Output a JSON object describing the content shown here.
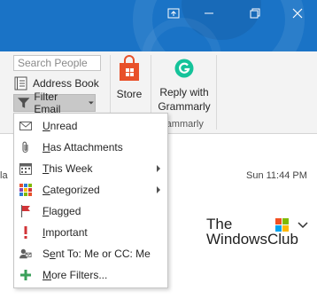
{
  "window": {
    "buttons": [
      {
        "name": "touch-mode-icon"
      },
      {
        "name": "minimize-icon"
      },
      {
        "name": "restore-icon"
      },
      {
        "name": "close-icon"
      }
    ]
  },
  "ribbon": {
    "search_placeholder": "Search People",
    "address_book_label": "Address Book",
    "filter_email_label": "Filter Email",
    "store_label": "Store",
    "reply_grammarly_line1": "Reply with",
    "reply_grammarly_line2": "Grammarly",
    "group_label_fragment": "rammarly"
  },
  "content": {
    "left_fragment": "la",
    "date": "Sun 11:44 PM",
    "watermark_line1": "The",
    "watermark_line2": "WindowsClub"
  },
  "menu": {
    "items": [
      {
        "label": "Unread",
        "hotkey_index": 0,
        "icon": "envelope-icon",
        "submenu": false
      },
      {
        "label": "Has Attachments",
        "hotkey_index": 0,
        "icon": "paperclip-icon",
        "submenu": false
      },
      {
        "label": "This Week",
        "hotkey_index": 0,
        "icon": "calendar-icon",
        "submenu": true
      },
      {
        "label": "Categorized",
        "hotkey_index": 0,
        "icon": "categories-icon",
        "submenu": true
      },
      {
        "label": "Flagged",
        "hotkey_index": 0,
        "icon": "flag-icon",
        "submenu": false
      },
      {
        "label": "Important",
        "hotkey_index": 0,
        "icon": "exclamation-icon",
        "submenu": false
      },
      {
        "label": "Sent To: Me or CC: Me",
        "hotkey_index": 1,
        "icon": "sent-to-icon",
        "submenu": false
      },
      {
        "label": "More Filters...",
        "hotkey_index": 0,
        "icon": "plus-icon",
        "submenu": false
      }
    ]
  },
  "colors": {
    "titlebar": "#1a73c6",
    "store_orange": "#e8512a",
    "grammarly_green": "#15c39a",
    "flag_red": "#d13438"
  }
}
